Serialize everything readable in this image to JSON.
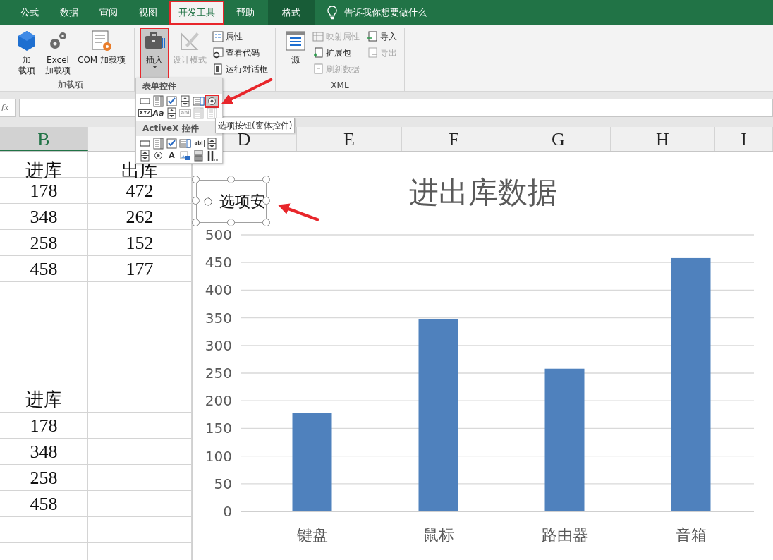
{
  "ribbon_tabs": [
    {
      "label": "公式",
      "selected": false,
      "kind": "normal",
      "highlighted": false
    },
    {
      "label": "数据",
      "selected": false,
      "kind": "normal",
      "highlighted": false
    },
    {
      "label": "审阅",
      "selected": false,
      "kind": "normal",
      "highlighted": false
    },
    {
      "label": "视图",
      "selected": false,
      "kind": "normal",
      "highlighted": false
    },
    {
      "label": "开发工具",
      "selected": true,
      "kind": "normal",
      "highlighted": true
    },
    {
      "label": "帮助",
      "selected": false,
      "kind": "normal",
      "highlighted": false
    },
    {
      "label": "格式",
      "selected": false,
      "kind": "contextual",
      "highlighted": false
    }
  ],
  "tell_me": {
    "label": "告诉我你想要做什么"
  },
  "ribbon_groups": [
    {
      "label": "加载项",
      "buttons": [
        {
          "kind": "large",
          "lines": [
            "加",
            "载项"
          ],
          "disabled": false
        },
        {
          "kind": "large",
          "lines": [
            "Excel",
            "加载项"
          ],
          "disabled": false
        },
        {
          "kind": "large",
          "lines": [
            "COM 加载项"
          ],
          "disabled": false
        }
      ]
    },
    {
      "buttons": [
        {
          "kind": "large",
          "lines": [
            "插入"
          ],
          "disabled": false,
          "pressed": true,
          "highlighted": true,
          "dropdown": true
        },
        {
          "kind": "large",
          "lines": [
            "设计模式"
          ],
          "disabled": true
        },
        {
          "kind": "small",
          "lines": [
            "属性"
          ],
          "disabled": false
        },
        {
          "kind": "small",
          "lines": [
            "查看代码"
          ],
          "disabled": false
        },
        {
          "kind": "small",
          "lines": [
            "运行对话框"
          ],
          "disabled": false
        }
      ]
    },
    {
      "label": "XML",
      "buttons": [
        {
          "kind": "large",
          "lines": [
            "源"
          ],
          "disabled": false
        },
        {
          "kind": "small",
          "lines": [
            "映射属性"
          ],
          "disabled": true
        },
        {
          "kind": "small",
          "lines": [
            "扩展包"
          ],
          "disabled": false
        },
        {
          "kind": "small",
          "lines": [
            "刷新数据"
          ],
          "disabled": true
        },
        {
          "kind": "small",
          "lines": [
            "导入"
          ],
          "disabled": false
        },
        {
          "kind": "small",
          "lines": [
            "导出"
          ],
          "disabled": true
        }
      ]
    }
  ],
  "formula_bar": {
    "fx": "fx"
  },
  "insert_menu": {
    "sections": [
      {
        "title": "表单控件",
        "items": [
          {
            "disabled": false
          },
          {
            "disabled": false
          },
          {
            "disabled": false
          },
          {
            "disabled": false
          },
          {
            "disabled": false
          },
          {
            "disabled": false,
            "highlighted": true
          },
          {
            "disabled": false,
            "glyph": "XYZ"
          },
          {
            "disabled": false,
            "glyph": "Aa"
          },
          {
            "disabled": false
          },
          {
            "disabled": true,
            "glyph": "abl"
          },
          {
            "disabled": true
          },
          {
            "disabled": true
          }
        ]
      },
      {
        "title": "ActiveX 控件",
        "items": [
          {
            "disabled": false
          },
          {
            "disabled": false
          },
          {
            "disabled": false
          },
          {
            "disabled": false
          },
          {
            "disabled": false,
            "glyph": "abl"
          },
          {
            "disabled": false
          },
          {
            "disabled": false
          },
          {
            "disabled": false
          },
          {
            "disabled": false,
            "glyph": "A"
          },
          {
            "disabled": false
          },
          {
            "disabled": false
          },
          {
            "disabled": false
          }
        ]
      }
    ],
    "tooltip": "选项按钮(窗体控件)"
  },
  "column_headers": [
    {
      "label": "B",
      "selected": true
    },
    {
      "label": "D",
      "selected": false
    },
    {
      "label": "E",
      "selected": false
    },
    {
      "label": "F",
      "selected": false
    },
    {
      "label": "G",
      "selected": false
    },
    {
      "label": "H",
      "selected": false
    },
    {
      "label": "I",
      "selected": false
    }
  ],
  "rows": [
    [
      "进库",
      "出库"
    ],
    [
      "178",
      "472"
    ],
    [
      "348",
      "262"
    ],
    [
      "258",
      "152"
    ],
    [
      "458",
      "177"
    ],
    [
      null,
      null
    ],
    [
      null,
      null
    ],
    [
      null,
      null
    ],
    [
      null,
      null
    ],
    [
      "进库",
      null
    ],
    [
      "178",
      null
    ],
    [
      "348",
      null
    ],
    [
      "258",
      null
    ],
    [
      "458",
      null
    ],
    [
      null,
      null
    ],
    [
      null,
      null
    ]
  ],
  "option_button": {
    "label": "选项安",
    "checked": false
  },
  "chart": {
    "chart_data": {
      "type": "bar",
      "title": "进出库数据",
      "categories": [
        "键盘",
        "鼠标",
        "路由器",
        "音箱"
      ],
      "series": [
        {
          "color": "#4f81bd",
          "values": [
            178,
            348,
            258,
            458
          ]
        }
      ],
      "ylim": [
        0,
        500
      ],
      "yticks": [
        0,
        50,
        100,
        150,
        200,
        250,
        300,
        350,
        400,
        450,
        500
      ],
      "grid": true
    }
  }
}
